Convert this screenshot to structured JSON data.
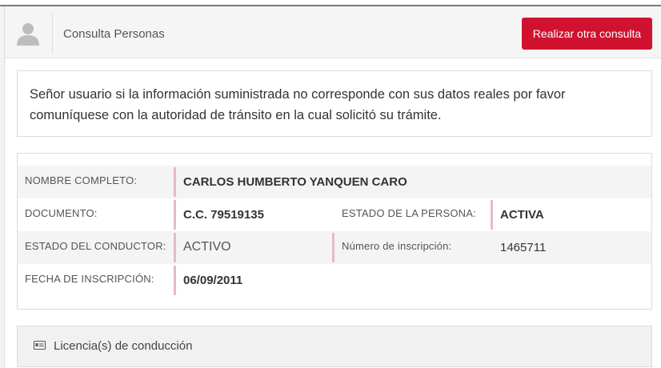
{
  "header": {
    "title": "Consulta Personas",
    "button_label": "Realizar otra consulta"
  },
  "notice": {
    "text": "Señor usuario si la información suministrada no corresponde con sus datos reales por favor comuníquese con la autoridad de tránsito en la cual solicitó su trámite."
  },
  "person": {
    "nombre_label": "NOMBRE COMPLETO:",
    "nombre_value": "CARLOS HUMBERTO YANQUEN CARO",
    "documento_label": "DOCUMENTO:",
    "documento_value": "C.C. 79519135",
    "estado_persona_label": "ESTADO DE LA PERSONA:",
    "estado_persona_value": "ACTIVA",
    "estado_conductor_label": "ESTADO DEL CONDUCTOR:",
    "estado_conductor_value": "ACTIVO",
    "inscripcion_label": "Número de inscripción:",
    "inscripcion_value": "1465711",
    "fecha_label": "FECHA DE INSCRIPCIÓN:",
    "fecha_value": "06/09/2011"
  },
  "licencias": {
    "label": "Licencia(s) de conducción",
    "icon": "id-card-icon"
  },
  "colors": {
    "accent": "#d0122f",
    "separator": "#e5bcc0"
  }
}
